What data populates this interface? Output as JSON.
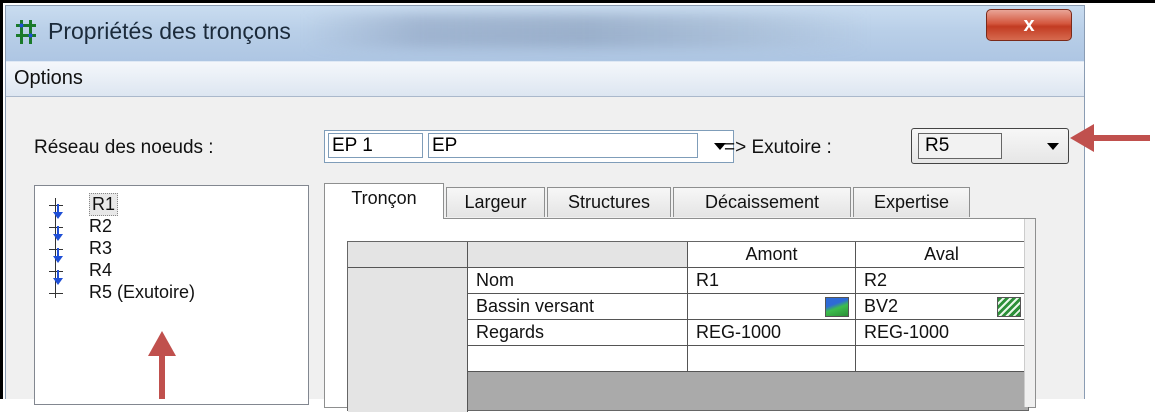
{
  "window": {
    "title": "Propriétés des tronçons",
    "close_symbol": "x"
  },
  "menu": {
    "options": "Options"
  },
  "network": {
    "label": "Réseau des noeuds :",
    "code": "EP 1",
    "name": "EP",
    "outlet_label": "=> Exutoire :",
    "outlet_value": "R5"
  },
  "tree": {
    "items": [
      {
        "label": "R1"
      },
      {
        "label": "R2"
      },
      {
        "label": "R3"
      },
      {
        "label": "R4"
      },
      {
        "label": "R5 (Exutoire)"
      }
    ]
  },
  "tabs": [
    {
      "label": "Tronçon"
    },
    {
      "label": "Largeur"
    },
    {
      "label": "Structures"
    },
    {
      "label": "Décaissement"
    },
    {
      "label": "Expertise"
    }
  ],
  "table": {
    "columns": [
      "Amont",
      "Aval"
    ],
    "rows": [
      {
        "label": "Nom",
        "amont": "R1",
        "aval": "R2"
      },
      {
        "label": "Bassin versant",
        "amont": "",
        "aval": "BV2"
      },
      {
        "label": "Regards",
        "amont": "REG-1000",
        "aval": "REG-1000"
      }
    ]
  },
  "colors": {
    "annotation_arrow": "#c0504d",
    "tree_arrow": "#1f4fd6"
  },
  "icons": [
    "network-icon",
    "dropdown-arrow-icon",
    "tree-down-arrow-icon",
    "watershed-icon"
  ]
}
